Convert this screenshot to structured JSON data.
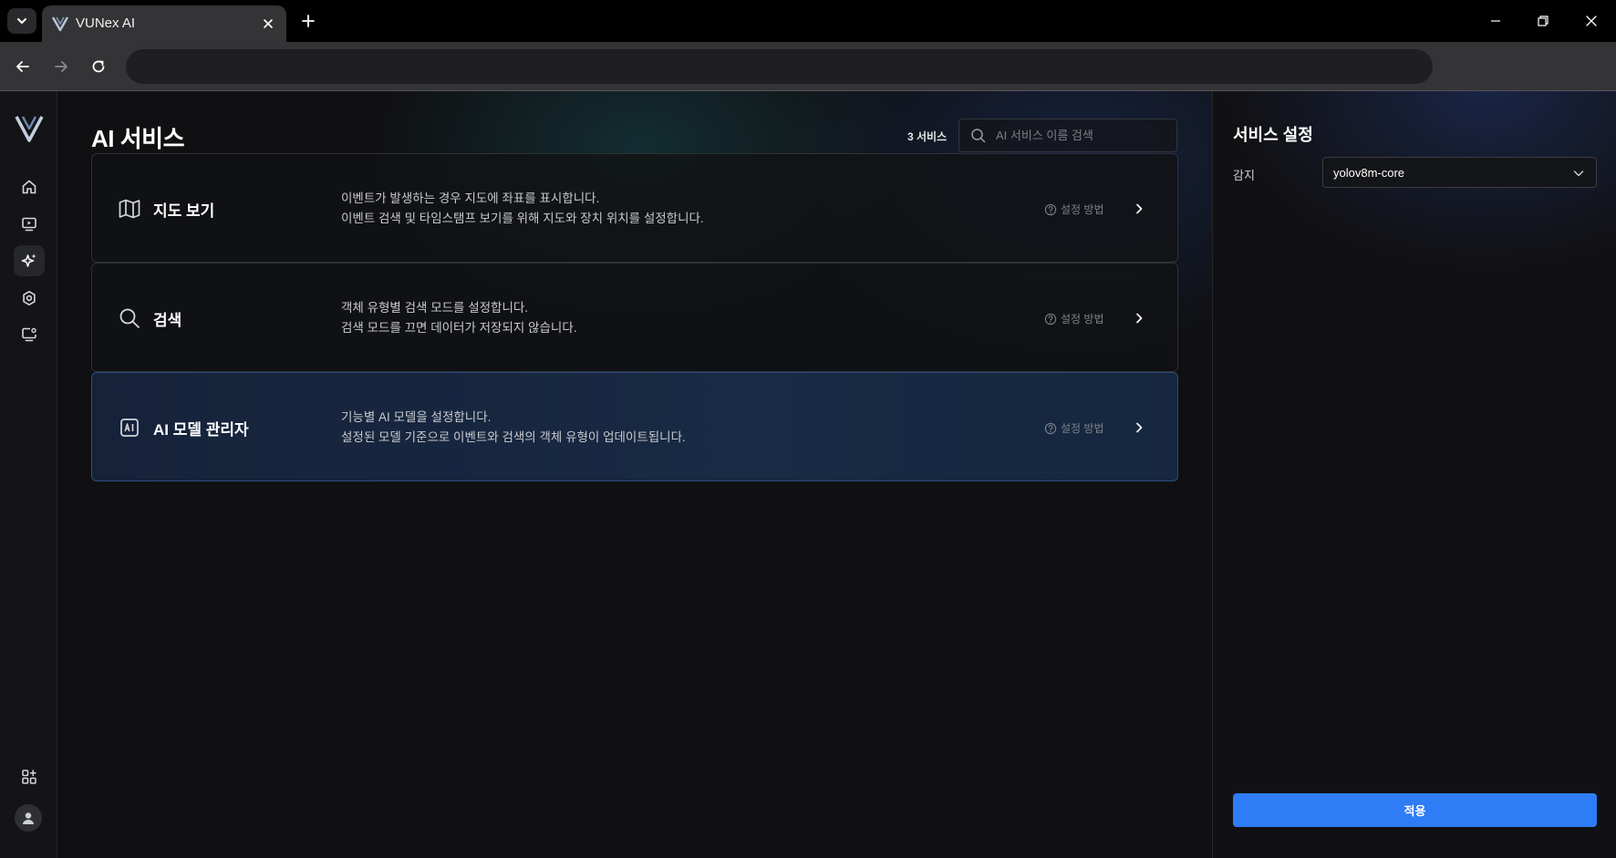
{
  "browser": {
    "tab_title": "VUNex AI",
    "address": ""
  },
  "sidebar": {
    "items": [
      {
        "name": "home",
        "icon": "home-icon"
      },
      {
        "name": "playback",
        "icon": "monitor-play-icon"
      },
      {
        "name": "ai-service",
        "icon": "sparkle-icon",
        "active": true
      },
      {
        "name": "settings",
        "icon": "gear-icon"
      },
      {
        "name": "system",
        "icon": "monitor-gear-icon"
      }
    ],
    "bottom": [
      {
        "name": "apps",
        "icon": "apps-add-icon"
      },
      {
        "name": "account",
        "icon": "avatar-icon"
      }
    ]
  },
  "main": {
    "title": "AI 서비스",
    "count_label": "3 서비스",
    "search_placeholder": "AI 서비스 이름 검색",
    "search_value": ""
  },
  "cards": [
    {
      "id": "map",
      "icon": "map-icon",
      "title": "지도 보기",
      "desc1": "이벤트가 발생하는 경우 지도에 좌표를 표시합니다.",
      "desc2": "이벤트 검색 및 타임스탬프 보기를 위해 지도와 장치 위치를 설정합니다.",
      "help": "설정 방법"
    },
    {
      "id": "search",
      "icon": "search-icon",
      "title": "검색",
      "desc1": "객체 유형별 검색 모드를 설정합니다.",
      "desc2": "검색 모드를 끄면 데이터가 저장되지 않습니다.",
      "help": "설정 방법"
    },
    {
      "id": "ai-model",
      "icon": "ai-chip-icon",
      "title": "AI 모델 관리자",
      "desc1": "기능별 AI 모델을 설정합니다.",
      "desc2": "설정된 모델 기준으로 이벤트와 검색의 객체 유형이 업데이트됩니다.",
      "help": "설정 방법",
      "selected": true
    }
  ],
  "panel": {
    "title": "서비스 설정",
    "detect_label": "감지",
    "model_value": "yolov8m-core",
    "apply_label": "적용"
  },
  "colors": {
    "accent": "#2e7cf6",
    "selected_card": "#182a44",
    "background": "#111112"
  }
}
